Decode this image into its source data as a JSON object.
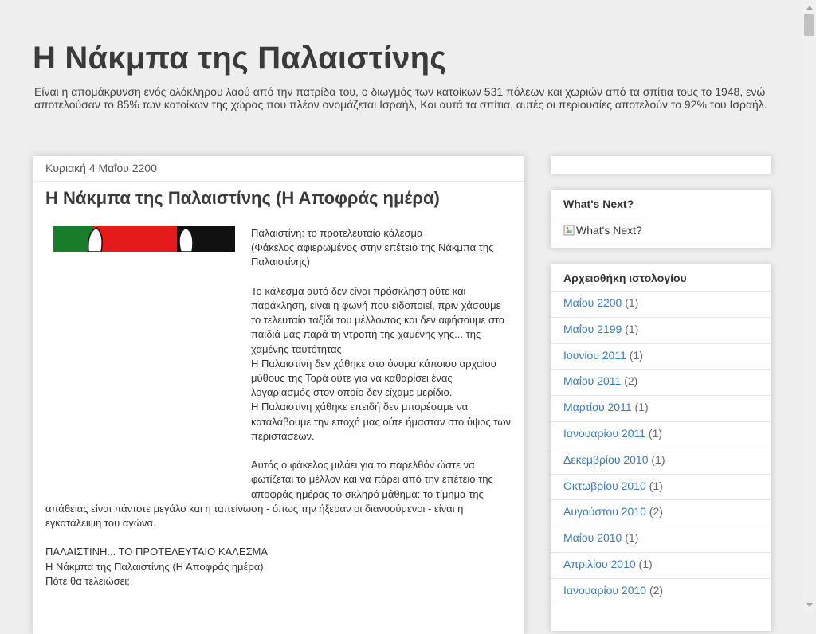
{
  "blog": {
    "title": "Η Νάκμπα της Παλαιστίνης",
    "description": "Είναι η απομάκρυνση ενός ολόκληρου λαού από την πατρίδα του, ο διωγμός των κατοίκων 531 πόλεων και χωριών από τα σπίτια τους το 1948, ενώ αποτελούσαν το 85% των κατοίκων της χώρας που πλέον ονομάζεται Ισραήλ, Και αυτά τα σπίτια, αυτές οι περιουσίες αποτελούν το 92% του Ισραήλ."
  },
  "post": {
    "date": "Κυριακή 4 Μαΐου 2200",
    "title": "Η Νάκμπα της Παλαιστίνης (Η Αποφράς ημέρα)",
    "image_icon": "palestinian-flag-image",
    "paragraphs": [
      "Παλαιστίνη: το προτελευταίο κάλεσμα\n(Φάκελος αφιερωμένος στην επέτειο της Νάκμπα της Παλαιστίνης)",
      "Το κάλεσμα αυτό δεν είναι πρόσκληση ούτε και παράκληση, είναι η φωνή που ειδοποιεί, πριν χάσουμε το τελευταίο ταξίδι του μέλλοντος και δεν αφήσουμε στα παιδιά μας παρά τη ντροπή της χαμένης γης... της χαμένης ταυτότητας.\nΗ Παλαιστίνη δεν χάθηκε στο όνομα κάποιου αρχαίου μύθους της Τορά ούτε για να καθαρίσει ένας λογαριασμός στον οποίο δεν είχαμε μερίδιο.\nΗ Παλαιστίνη χάθηκε επειδή δεν μπορέσαμε να καταλάβουμε την εποχή μας ούτε ήμασταν στο ύψος των περιστάσεων.",
      "Αυτός ο φάκελος μιλάει για το παρελθόν ώστε να φωτίζεται το μέλλον και να πάρει από την επέτειο της αποφράς ημέρας το σκληρό μάθημα: το τίμημα της απάθειας είναι πάντοτε μεγάλο και η ταπείνωση - όπως την ήξεραν οι διανοούμενοι - είναι η εγκατάλειψη του αγώνα."
    ],
    "lines_after": [
      "ΠΑΛΑΙΣΤΙΝΗ... ΤΟ ΠΡΟΤΕΛΕΥΤΑΙΟ ΚΑΛΕΣΜΑ",
      "Η Νάκμπα της Παλαιστίνης (Η Αποφράς ημέρα)",
      "Πότε θα τελειώσει;"
    ]
  },
  "sidebar": {
    "whats_next": {
      "title": "What's Next?",
      "image_alt": "What's Next?"
    },
    "archive": {
      "title": "Αρχειοθήκη ιστολογίου",
      "items": [
        {
          "label": "Μαΐου 2200",
          "count": "(1)"
        },
        {
          "label": "Μαΐου 2199",
          "count": "(1)"
        },
        {
          "label": "Ιουνίου 2011",
          "count": "(1)"
        },
        {
          "label": "Μαΐου 2011",
          "count": "(2)"
        },
        {
          "label": "Μαρτίου 2011",
          "count": "(1)"
        },
        {
          "label": "Ιανουαρίου 2011",
          "count": "(1)"
        },
        {
          "label": "Δεκεμβρίου 2010",
          "count": "(1)"
        },
        {
          "label": "Οκτωβρίου 2010",
          "count": "(1)"
        },
        {
          "label": "Αυγούστου 2010",
          "count": "(2)"
        },
        {
          "label": "Μαΐου 2010",
          "count": "(1)"
        },
        {
          "label": "Απριλίου 2010",
          "count": "(1)"
        },
        {
          "label": "Ιανουαρίου 2010",
          "count": "(2)"
        }
      ]
    }
  },
  "colors": {
    "link": "#3a7bbf",
    "background": "#eeeeee",
    "title": "#3a3a3a"
  }
}
